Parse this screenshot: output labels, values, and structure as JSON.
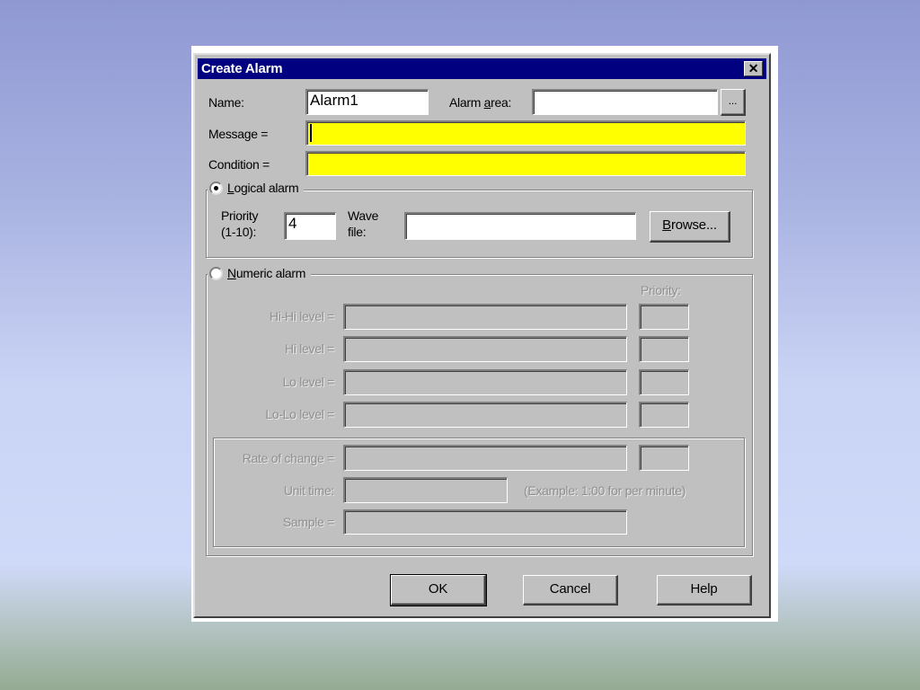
{
  "window": {
    "title": "Create Alarm",
    "close_glyph": "✕"
  },
  "fields": {
    "name_label": "Name:",
    "name_value": "Alarm1",
    "alarm_area_label_pre": "Alarm ",
    "alarm_area_label_u": "a",
    "alarm_area_label_post": "rea:",
    "alarm_area_value": "",
    "browse_area_label": "...",
    "message_label": "Message =",
    "message_value": "",
    "condition_label": "Condition =",
    "condition_value": ""
  },
  "logical": {
    "title_u": "L",
    "title_rest": "ogical alarm",
    "checked": true,
    "priority_label_1": "Priority",
    "priority_label_2": "(1-10):",
    "priority_value": "4",
    "wave_label_1": "Wave",
    "wave_label_2": "file:",
    "wave_value": "",
    "browse_u": "B",
    "browse_rest": "rowse..."
  },
  "numeric": {
    "title_u": "N",
    "title_rest": "umeric alarm",
    "checked": false,
    "priority_header": "Priority:",
    "levels": [
      {
        "label": "Hi-Hi level ="
      },
      {
        "label": "Hi level ="
      },
      {
        "label": "Lo level ="
      },
      {
        "label": "Lo-Lo level ="
      }
    ],
    "rate_label": "Rate of change =",
    "unit_time_label": "Unit time:",
    "unit_time_example": "(Example: 1:00 for per minute)",
    "sample_label": "Sample ="
  },
  "buttons": {
    "ok": "OK",
    "cancel": "Cancel",
    "help": "Help"
  },
  "colors": {
    "titlebar": "#000080",
    "required_field": "#ffff00",
    "face": "#c0c0c0"
  }
}
